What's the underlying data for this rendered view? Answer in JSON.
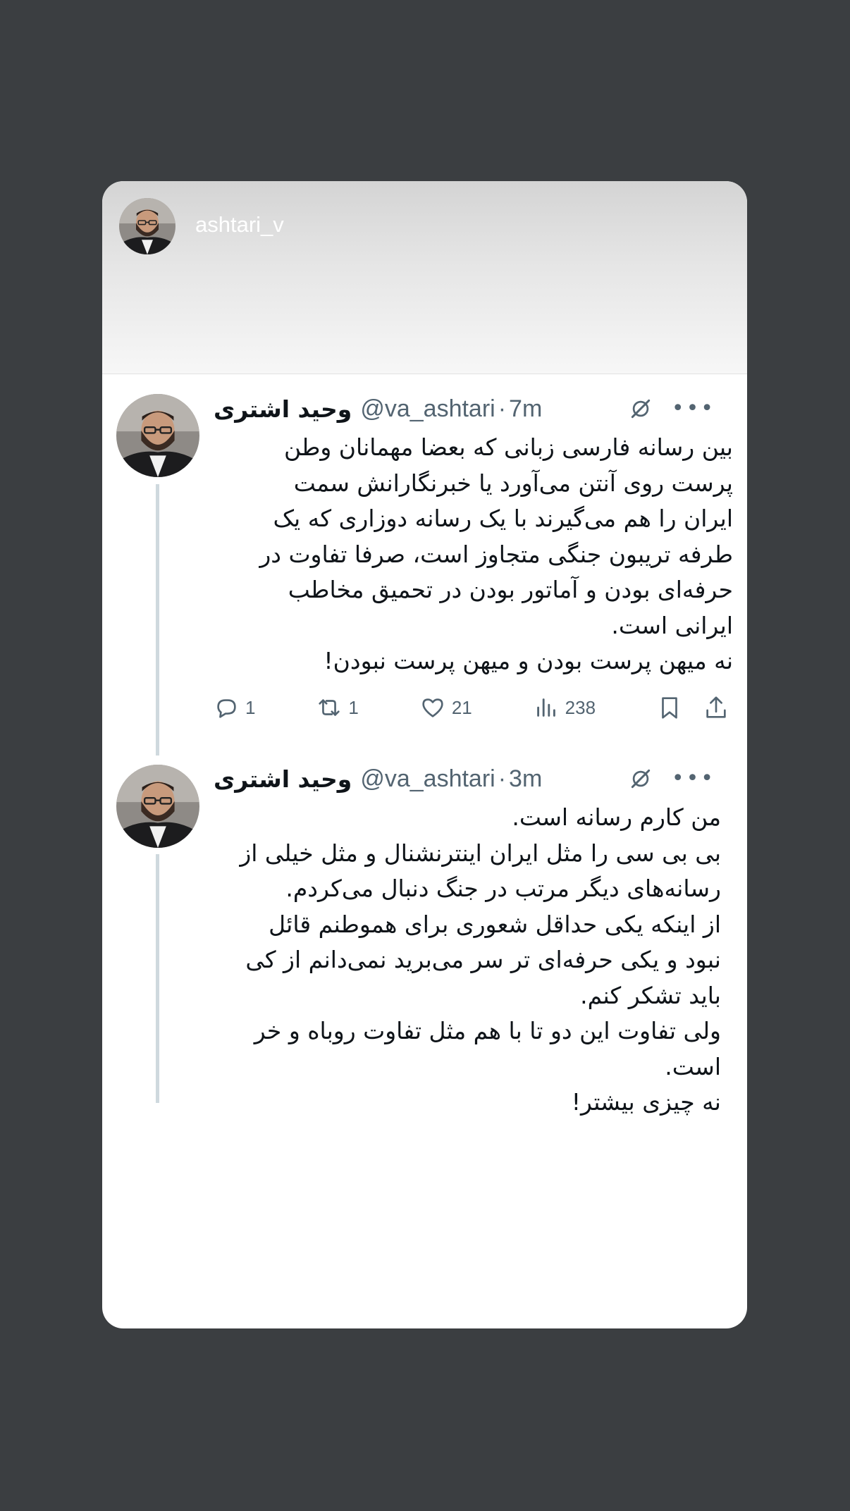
{
  "story": {
    "username": "ashtari_v"
  },
  "tweets": [
    {
      "name": "وحید اشتری",
      "handle": "@va_ashtari",
      "dot": "·",
      "time": "7m",
      "lines": [
        "بین رسانه فارسی زبانی که بعضا مهمانان وطن",
        "پرست روی آنتن می‌آورد یا خبرنگارانش سمت",
        "ایران را هم می‌گیرند با یک رسانه دوزاری که یک",
        "طرفه تریبون جنگی متجاوز است، صرفا تفاوت در",
        "حرفه‌ای بودن و آماتور بودن در تحمیق مخاطب",
        "ایرانی است.",
        "نه میهن پرست بودن و میهن پرست نبودن!"
      ],
      "replies": "1",
      "retweets": "1",
      "likes": "21",
      "views": "238"
    },
    {
      "name": "وحید اشتری",
      "handle": "@va_ashtari",
      "dot": "·",
      "time": "3m",
      "lines": [
        "من کارم رسانه است.",
        "بی بی سی را مثل ایران اینترنشنال و مثل خیلی از",
        "رسانه‌های دیگر مرتب در جنگ دنبال می‌کردم.",
        "از اینکه یکی حداقل شعوری برای هموطنم قائل",
        "نبود و یکی حرفه‌ای تر سر می‌برید نمی‌دانم از کی",
        "باید تشکر کنم.",
        "ولی تفاوت این دو تا با هم مثل تفاوت روباه و خر",
        "است.",
        "نه چیزی بیشتر!"
      ]
    }
  ],
  "icons": {
    "grok": "grok-icon",
    "more": "more-icon",
    "reply": "reply-icon",
    "retweet": "retweet-icon",
    "like": "heart-icon",
    "views": "views-icon",
    "bookmark": "bookmark-icon",
    "share": "share-icon"
  },
  "colors": {
    "background": "#3b3e41",
    "card": "#ffffff",
    "text": "#0f1419",
    "muted": "#536471",
    "thread": "#cfd9de"
  }
}
